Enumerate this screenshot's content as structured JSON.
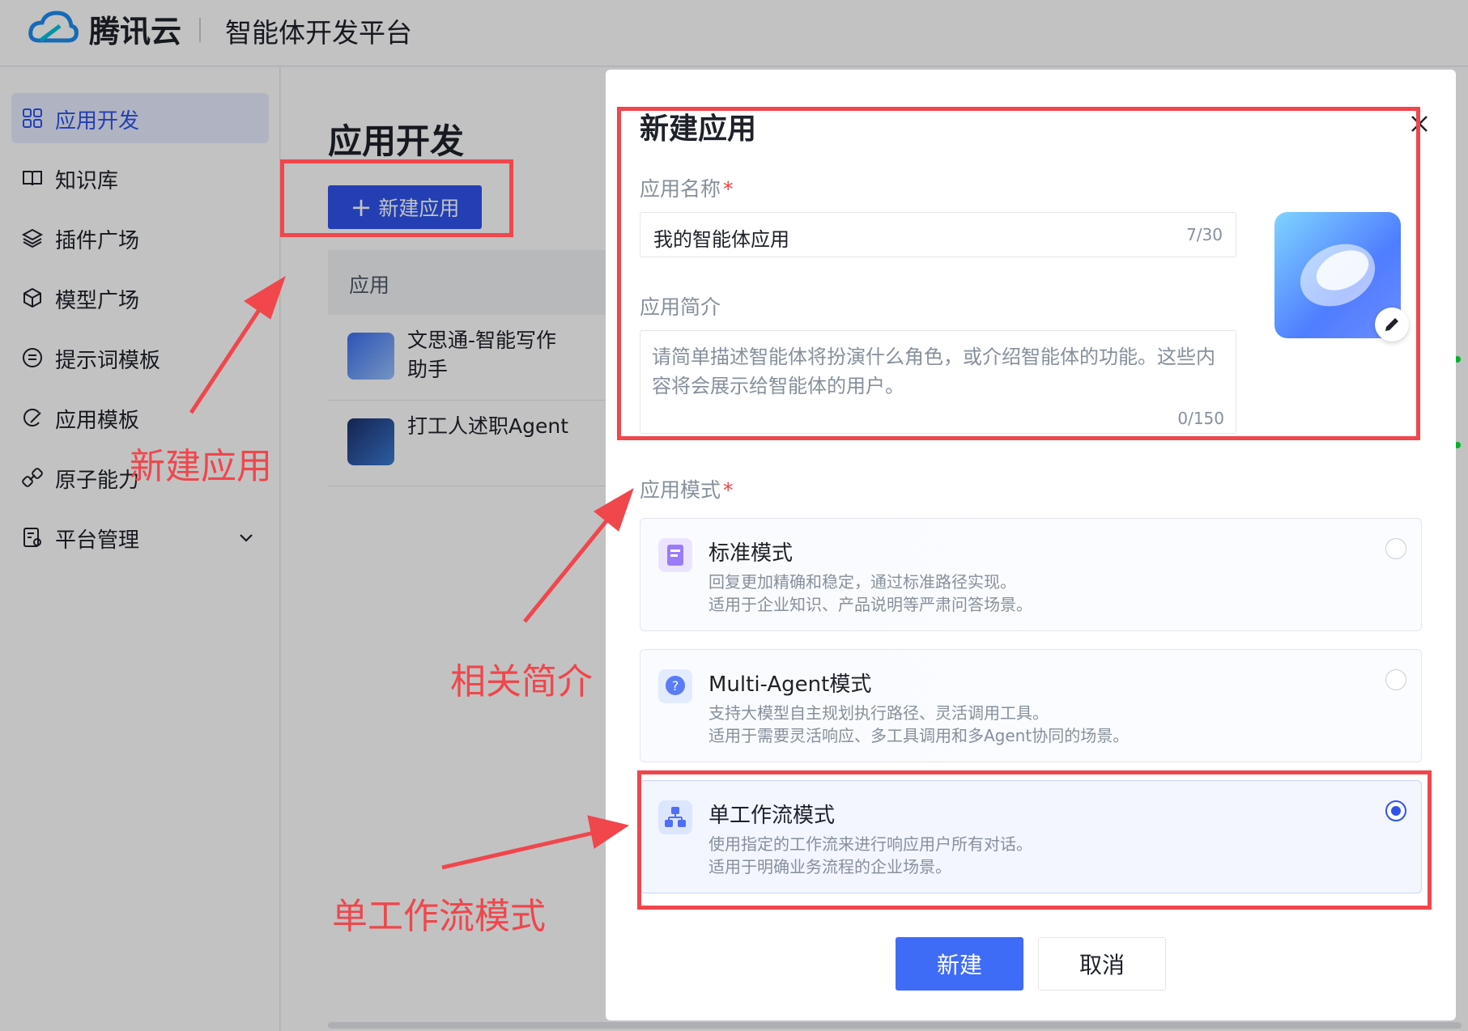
{
  "topbar": {
    "brand": "腾讯云",
    "platform": "智能体开发平台"
  },
  "sidebar": {
    "items": [
      {
        "label": "应用开发",
        "icon": "grid-icon"
      },
      {
        "label": "知识库",
        "icon": "book-icon"
      },
      {
        "label": "插件广场",
        "icon": "layers-icon"
      },
      {
        "label": "模型广场",
        "icon": "cube-icon"
      },
      {
        "label": "提示词模板",
        "icon": "prompt-icon"
      },
      {
        "label": "应用模板",
        "icon": "template-icon"
      },
      {
        "label": "原子能力",
        "icon": "link-icon"
      },
      {
        "label": "平台管理",
        "icon": "manage-icon"
      }
    ]
  },
  "main": {
    "title": "应用开发",
    "new_button": "新建应用",
    "table_header": "应用",
    "rows": [
      {
        "name": "文思通-智能写作助手"
      },
      {
        "name": "打工人述职Agent"
      }
    ]
  },
  "modal": {
    "title": "新建应用",
    "name_label": "应用名称",
    "name_value": "我的智能体应用",
    "name_count": "7/30",
    "desc_label": "应用简介",
    "desc_placeholder": "请简单描述智能体将扮演什么角色，或介绍智能体的功能。这些内容将会展示给智能体的用户。",
    "desc_count": "0/150",
    "mode_label": "应用模式",
    "required_mark": "*",
    "modes": [
      {
        "name": "标准模式",
        "line1": "回复更加精确和稳定，通过标准路径实现。",
        "line2": "适用于企业知识、产品说明等严肃问答场景。",
        "selected": false
      },
      {
        "name": "Multi-Agent模式",
        "line1": "支持大模型自主规划执行路径、灵活调用工具。",
        "line2": "适用于需要灵活响应、多工具调用和多Agent协同的场景。",
        "selected": false
      },
      {
        "name": "单工作流模式",
        "line1": "使用指定的工作流来进行响应用户所有对话。",
        "line2": "适用于明确业务流程的企业场景。",
        "selected": true
      }
    ],
    "create_button": "新建",
    "cancel_button": "取消"
  },
  "annotations": {
    "new_app": "新建应用",
    "intro": "相关简介",
    "workflow": "单工作流模式",
    "color": "#f0464c"
  },
  "colors": {
    "primary": "#2f54eb",
    "accent_red": "#f0464c"
  }
}
